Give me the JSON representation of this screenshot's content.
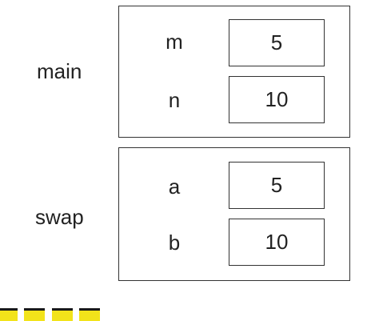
{
  "frames": [
    {
      "label": "main",
      "vars": [
        {
          "name": "m",
          "value": "5"
        },
        {
          "name": "n",
          "value": "10"
        }
      ]
    },
    {
      "label": "swap",
      "vars": [
        {
          "name": "a",
          "value": "5"
        },
        {
          "name": "b",
          "value": "10"
        }
      ]
    }
  ],
  "colors": {
    "border": "#333333",
    "text": "#222222",
    "caption_highlight": "#f2e31a"
  }
}
